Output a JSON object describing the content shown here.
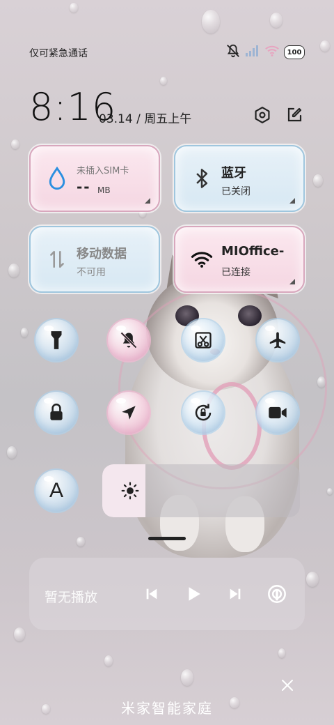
{
  "status_bar": {
    "carrier": "仅可紧急通话",
    "battery": "100"
  },
  "header": {
    "time": "8:16",
    "date": "03.14 / 周五上午"
  },
  "tiles": {
    "data_usage": {
      "label": "未插入SIM卡",
      "value": "--",
      "unit": "MB"
    },
    "bluetooth": {
      "title": "蓝牙",
      "status": "已关闭"
    },
    "mobile_data": {
      "title": "移动数据",
      "status": "不可用"
    },
    "wifi": {
      "title": "MIOffice-",
      "status": "已连接"
    }
  },
  "toggles": [
    {
      "name": "flashlight",
      "active": false
    },
    {
      "name": "mute",
      "active": true
    },
    {
      "name": "screenshot",
      "active": false
    },
    {
      "name": "airplane-mode",
      "active": false
    },
    {
      "name": "lock-screen",
      "active": false
    },
    {
      "name": "location",
      "active": true
    },
    {
      "name": "rotation-lock",
      "active": false
    },
    {
      "name": "screen-record",
      "active": false
    },
    {
      "name": "font-size",
      "active": false,
      "glyph": "A"
    }
  ],
  "brightness": {
    "level": 0.22
  },
  "media": {
    "title": "暂无播放"
  },
  "footer": {
    "title": "米家智能家庭"
  },
  "colors": {
    "pink_tile": "#f5d6e2",
    "blue_tile": "#d7e8f3",
    "wifi_icon": "#111111",
    "drop_icon": "#2a8fe0"
  }
}
